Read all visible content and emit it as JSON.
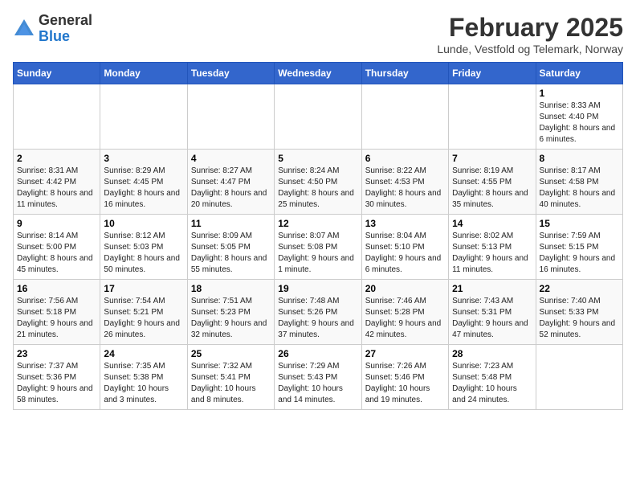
{
  "header": {
    "logo_general": "General",
    "logo_blue": "Blue",
    "month_title": "February 2025",
    "location": "Lunde, Vestfold og Telemark, Norway"
  },
  "columns": [
    "Sunday",
    "Monday",
    "Tuesday",
    "Wednesday",
    "Thursday",
    "Friday",
    "Saturday"
  ],
  "weeks": [
    [
      {
        "day": "",
        "info": ""
      },
      {
        "day": "",
        "info": ""
      },
      {
        "day": "",
        "info": ""
      },
      {
        "day": "",
        "info": ""
      },
      {
        "day": "",
        "info": ""
      },
      {
        "day": "",
        "info": ""
      },
      {
        "day": "1",
        "info": "Sunrise: 8:33 AM\nSunset: 4:40 PM\nDaylight: 8 hours and 6 minutes."
      }
    ],
    [
      {
        "day": "2",
        "info": "Sunrise: 8:31 AM\nSunset: 4:42 PM\nDaylight: 8 hours and 11 minutes."
      },
      {
        "day": "3",
        "info": "Sunrise: 8:29 AM\nSunset: 4:45 PM\nDaylight: 8 hours and 16 minutes."
      },
      {
        "day": "4",
        "info": "Sunrise: 8:27 AM\nSunset: 4:47 PM\nDaylight: 8 hours and 20 minutes."
      },
      {
        "day": "5",
        "info": "Sunrise: 8:24 AM\nSunset: 4:50 PM\nDaylight: 8 hours and 25 minutes."
      },
      {
        "day": "6",
        "info": "Sunrise: 8:22 AM\nSunset: 4:53 PM\nDaylight: 8 hours and 30 minutes."
      },
      {
        "day": "7",
        "info": "Sunrise: 8:19 AM\nSunset: 4:55 PM\nDaylight: 8 hours and 35 minutes."
      },
      {
        "day": "8",
        "info": "Sunrise: 8:17 AM\nSunset: 4:58 PM\nDaylight: 8 hours and 40 minutes."
      }
    ],
    [
      {
        "day": "9",
        "info": "Sunrise: 8:14 AM\nSunset: 5:00 PM\nDaylight: 8 hours and 45 minutes."
      },
      {
        "day": "10",
        "info": "Sunrise: 8:12 AM\nSunset: 5:03 PM\nDaylight: 8 hours and 50 minutes."
      },
      {
        "day": "11",
        "info": "Sunrise: 8:09 AM\nSunset: 5:05 PM\nDaylight: 8 hours and 55 minutes."
      },
      {
        "day": "12",
        "info": "Sunrise: 8:07 AM\nSunset: 5:08 PM\nDaylight: 9 hours and 1 minute."
      },
      {
        "day": "13",
        "info": "Sunrise: 8:04 AM\nSunset: 5:10 PM\nDaylight: 9 hours and 6 minutes."
      },
      {
        "day": "14",
        "info": "Sunrise: 8:02 AM\nSunset: 5:13 PM\nDaylight: 9 hours and 11 minutes."
      },
      {
        "day": "15",
        "info": "Sunrise: 7:59 AM\nSunset: 5:15 PM\nDaylight: 9 hours and 16 minutes."
      }
    ],
    [
      {
        "day": "16",
        "info": "Sunrise: 7:56 AM\nSunset: 5:18 PM\nDaylight: 9 hours and 21 minutes."
      },
      {
        "day": "17",
        "info": "Sunrise: 7:54 AM\nSunset: 5:21 PM\nDaylight: 9 hours and 26 minutes."
      },
      {
        "day": "18",
        "info": "Sunrise: 7:51 AM\nSunset: 5:23 PM\nDaylight: 9 hours and 32 minutes."
      },
      {
        "day": "19",
        "info": "Sunrise: 7:48 AM\nSunset: 5:26 PM\nDaylight: 9 hours and 37 minutes."
      },
      {
        "day": "20",
        "info": "Sunrise: 7:46 AM\nSunset: 5:28 PM\nDaylight: 9 hours and 42 minutes."
      },
      {
        "day": "21",
        "info": "Sunrise: 7:43 AM\nSunset: 5:31 PM\nDaylight: 9 hours and 47 minutes."
      },
      {
        "day": "22",
        "info": "Sunrise: 7:40 AM\nSunset: 5:33 PM\nDaylight: 9 hours and 52 minutes."
      }
    ],
    [
      {
        "day": "23",
        "info": "Sunrise: 7:37 AM\nSunset: 5:36 PM\nDaylight: 9 hours and 58 minutes."
      },
      {
        "day": "24",
        "info": "Sunrise: 7:35 AM\nSunset: 5:38 PM\nDaylight: 10 hours and 3 minutes."
      },
      {
        "day": "25",
        "info": "Sunrise: 7:32 AM\nSunset: 5:41 PM\nDaylight: 10 hours and 8 minutes."
      },
      {
        "day": "26",
        "info": "Sunrise: 7:29 AM\nSunset: 5:43 PM\nDaylight: 10 hours and 14 minutes."
      },
      {
        "day": "27",
        "info": "Sunrise: 7:26 AM\nSunset: 5:46 PM\nDaylight: 10 hours and 19 minutes."
      },
      {
        "day": "28",
        "info": "Sunrise: 7:23 AM\nSunset: 5:48 PM\nDaylight: 10 hours and 24 minutes."
      },
      {
        "day": "",
        "info": ""
      }
    ]
  ]
}
